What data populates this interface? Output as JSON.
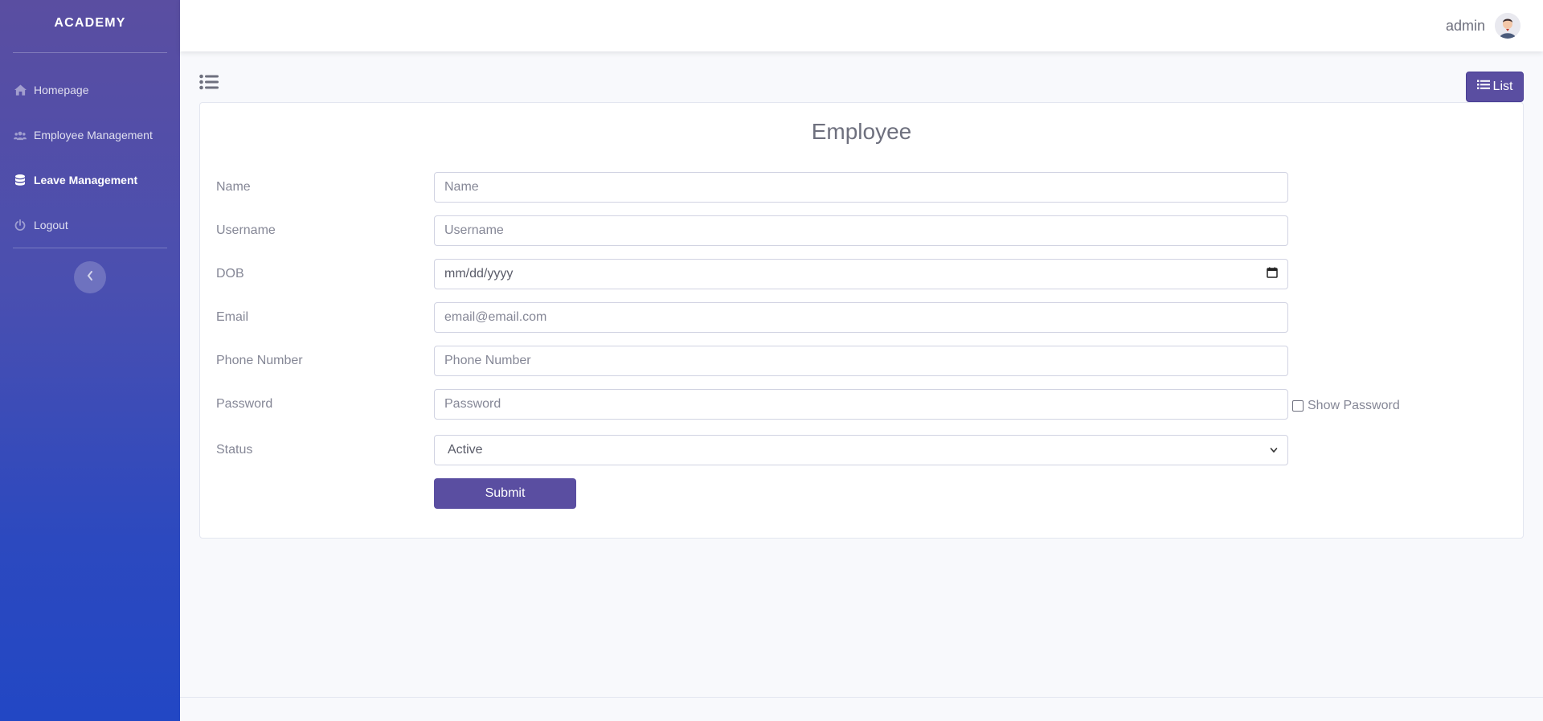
{
  "sidebar": {
    "brand": "ACADEMY",
    "items": [
      {
        "label": "Homepage",
        "icon": "home-icon"
      },
      {
        "label": "Employee Management",
        "icon": "users-icon"
      },
      {
        "label": "Leave Management",
        "icon": "database-icon",
        "active": true
      },
      {
        "label": "Logout",
        "icon": "power-icon"
      }
    ]
  },
  "topbar": {
    "user_name": "admin"
  },
  "toolbar": {
    "list_label": "List"
  },
  "form": {
    "title": "Employee",
    "fields": {
      "name": {
        "label": "Name",
        "placeholder": "Name"
      },
      "username": {
        "label": "Username",
        "placeholder": "Username"
      },
      "dob": {
        "label": "DOB",
        "placeholder": "mm/dd/yyyy"
      },
      "email": {
        "label": "Email",
        "placeholder": "email@email.com"
      },
      "phone": {
        "label": "Phone Number",
        "placeholder": "Phone Number"
      },
      "password": {
        "label": "Password",
        "placeholder": "Password",
        "show_label": "Show Password"
      },
      "status": {
        "label": "Status",
        "value": "Active"
      }
    },
    "submit_label": "Submit"
  },
  "colors": {
    "primary": "#5a4ea1",
    "sidebar_top": "#5a4ea1",
    "sidebar_bottom": "#2247c4",
    "background": "#f8f9fc"
  }
}
